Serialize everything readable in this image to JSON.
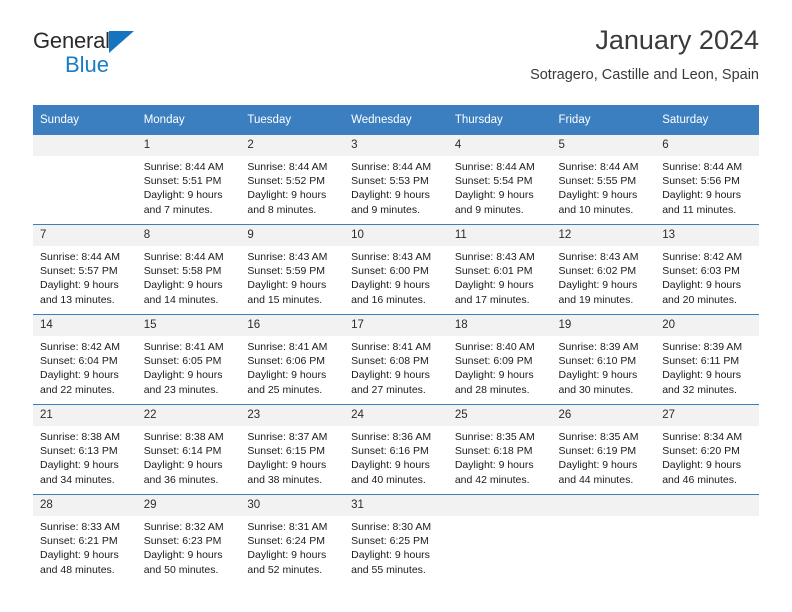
{
  "logo": {
    "word_top": "General",
    "word_bottom": "Blue",
    "triangle_icon": "blue-triangle-icon",
    "accent_color": "#1573bf"
  },
  "header": {
    "title": "January 2024",
    "subtitle": "Sotragero, Castille and Leon, Spain",
    "header_bg_color": "#3c7fc1",
    "daynum_bg_color": "#f2f2f2"
  },
  "calendar": {
    "weekday_headers": [
      "Sunday",
      "Monday",
      "Tuesday",
      "Wednesday",
      "Thursday",
      "Friday",
      "Saturday"
    ],
    "weeks": [
      [
        {
          "day": "",
          "sunrise": "",
          "sunset": "",
          "daylight_1": "",
          "daylight_2": "",
          "empty": true
        },
        {
          "day": "1",
          "sunrise": "Sunrise: 8:44 AM",
          "sunset": "Sunset: 5:51 PM",
          "daylight_1": "Daylight: 9 hours",
          "daylight_2": "and 7 minutes."
        },
        {
          "day": "2",
          "sunrise": "Sunrise: 8:44 AM",
          "sunset": "Sunset: 5:52 PM",
          "daylight_1": "Daylight: 9 hours",
          "daylight_2": "and 8 minutes."
        },
        {
          "day": "3",
          "sunrise": "Sunrise: 8:44 AM",
          "sunset": "Sunset: 5:53 PM",
          "daylight_1": "Daylight: 9 hours",
          "daylight_2": "and 9 minutes."
        },
        {
          "day": "4",
          "sunrise": "Sunrise: 8:44 AM",
          "sunset": "Sunset: 5:54 PM",
          "daylight_1": "Daylight: 9 hours",
          "daylight_2": "and 9 minutes."
        },
        {
          "day": "5",
          "sunrise": "Sunrise: 8:44 AM",
          "sunset": "Sunset: 5:55 PM",
          "daylight_1": "Daylight: 9 hours",
          "daylight_2": "and 10 minutes."
        },
        {
          "day": "6",
          "sunrise": "Sunrise: 8:44 AM",
          "sunset": "Sunset: 5:56 PM",
          "daylight_1": "Daylight: 9 hours",
          "daylight_2": "and 11 minutes."
        }
      ],
      [
        {
          "day": "7",
          "sunrise": "Sunrise: 8:44 AM",
          "sunset": "Sunset: 5:57 PM",
          "daylight_1": "Daylight: 9 hours",
          "daylight_2": "and 13 minutes."
        },
        {
          "day": "8",
          "sunrise": "Sunrise: 8:44 AM",
          "sunset": "Sunset: 5:58 PM",
          "daylight_1": "Daylight: 9 hours",
          "daylight_2": "and 14 minutes."
        },
        {
          "day": "9",
          "sunrise": "Sunrise: 8:43 AM",
          "sunset": "Sunset: 5:59 PM",
          "daylight_1": "Daylight: 9 hours",
          "daylight_2": "and 15 minutes."
        },
        {
          "day": "10",
          "sunrise": "Sunrise: 8:43 AM",
          "sunset": "Sunset: 6:00 PM",
          "daylight_1": "Daylight: 9 hours",
          "daylight_2": "and 16 minutes."
        },
        {
          "day": "11",
          "sunrise": "Sunrise: 8:43 AM",
          "sunset": "Sunset: 6:01 PM",
          "daylight_1": "Daylight: 9 hours",
          "daylight_2": "and 17 minutes."
        },
        {
          "day": "12",
          "sunrise": "Sunrise: 8:43 AM",
          "sunset": "Sunset: 6:02 PM",
          "daylight_1": "Daylight: 9 hours",
          "daylight_2": "and 19 minutes."
        },
        {
          "day": "13",
          "sunrise": "Sunrise: 8:42 AM",
          "sunset": "Sunset: 6:03 PM",
          "daylight_1": "Daylight: 9 hours",
          "daylight_2": "and 20 minutes."
        }
      ],
      [
        {
          "day": "14",
          "sunrise": "Sunrise: 8:42 AM",
          "sunset": "Sunset: 6:04 PM",
          "daylight_1": "Daylight: 9 hours",
          "daylight_2": "and 22 minutes."
        },
        {
          "day": "15",
          "sunrise": "Sunrise: 8:41 AM",
          "sunset": "Sunset: 6:05 PM",
          "daylight_1": "Daylight: 9 hours",
          "daylight_2": "and 23 minutes."
        },
        {
          "day": "16",
          "sunrise": "Sunrise: 8:41 AM",
          "sunset": "Sunset: 6:06 PM",
          "daylight_1": "Daylight: 9 hours",
          "daylight_2": "and 25 minutes."
        },
        {
          "day": "17",
          "sunrise": "Sunrise: 8:41 AM",
          "sunset": "Sunset: 6:08 PM",
          "daylight_1": "Daylight: 9 hours",
          "daylight_2": "and 27 minutes."
        },
        {
          "day": "18",
          "sunrise": "Sunrise: 8:40 AM",
          "sunset": "Sunset: 6:09 PM",
          "daylight_1": "Daylight: 9 hours",
          "daylight_2": "and 28 minutes."
        },
        {
          "day": "19",
          "sunrise": "Sunrise: 8:39 AM",
          "sunset": "Sunset: 6:10 PM",
          "daylight_1": "Daylight: 9 hours",
          "daylight_2": "and 30 minutes."
        },
        {
          "day": "20",
          "sunrise": "Sunrise: 8:39 AM",
          "sunset": "Sunset: 6:11 PM",
          "daylight_1": "Daylight: 9 hours",
          "daylight_2": "and 32 minutes."
        }
      ],
      [
        {
          "day": "21",
          "sunrise": "Sunrise: 8:38 AM",
          "sunset": "Sunset: 6:13 PM",
          "daylight_1": "Daylight: 9 hours",
          "daylight_2": "and 34 minutes."
        },
        {
          "day": "22",
          "sunrise": "Sunrise: 8:38 AM",
          "sunset": "Sunset: 6:14 PM",
          "daylight_1": "Daylight: 9 hours",
          "daylight_2": "and 36 minutes."
        },
        {
          "day": "23",
          "sunrise": "Sunrise: 8:37 AM",
          "sunset": "Sunset: 6:15 PM",
          "daylight_1": "Daylight: 9 hours",
          "daylight_2": "and 38 minutes."
        },
        {
          "day": "24",
          "sunrise": "Sunrise: 8:36 AM",
          "sunset": "Sunset: 6:16 PM",
          "daylight_1": "Daylight: 9 hours",
          "daylight_2": "and 40 minutes."
        },
        {
          "day": "25",
          "sunrise": "Sunrise: 8:35 AM",
          "sunset": "Sunset: 6:18 PM",
          "daylight_1": "Daylight: 9 hours",
          "daylight_2": "and 42 minutes."
        },
        {
          "day": "26",
          "sunrise": "Sunrise: 8:35 AM",
          "sunset": "Sunset: 6:19 PM",
          "daylight_1": "Daylight: 9 hours",
          "daylight_2": "and 44 minutes."
        },
        {
          "day": "27",
          "sunrise": "Sunrise: 8:34 AM",
          "sunset": "Sunset: 6:20 PM",
          "daylight_1": "Daylight: 9 hours",
          "daylight_2": "and 46 minutes."
        }
      ],
      [
        {
          "day": "28",
          "sunrise": "Sunrise: 8:33 AM",
          "sunset": "Sunset: 6:21 PM",
          "daylight_1": "Daylight: 9 hours",
          "daylight_2": "and 48 minutes."
        },
        {
          "day": "29",
          "sunrise": "Sunrise: 8:32 AM",
          "sunset": "Sunset: 6:23 PM",
          "daylight_1": "Daylight: 9 hours",
          "daylight_2": "and 50 minutes."
        },
        {
          "day": "30",
          "sunrise": "Sunrise: 8:31 AM",
          "sunset": "Sunset: 6:24 PM",
          "daylight_1": "Daylight: 9 hours",
          "daylight_2": "and 52 minutes."
        },
        {
          "day": "31",
          "sunrise": "Sunrise: 8:30 AM",
          "sunset": "Sunset: 6:25 PM",
          "daylight_1": "Daylight: 9 hours",
          "daylight_2": "and 55 minutes."
        },
        {
          "day": "",
          "sunrise": "",
          "sunset": "",
          "daylight_1": "",
          "daylight_2": "",
          "empty": true
        },
        {
          "day": "",
          "sunrise": "",
          "sunset": "",
          "daylight_1": "",
          "daylight_2": "",
          "empty": true
        },
        {
          "day": "",
          "sunrise": "",
          "sunset": "",
          "daylight_1": "",
          "daylight_2": "",
          "empty": true
        }
      ]
    ]
  }
}
